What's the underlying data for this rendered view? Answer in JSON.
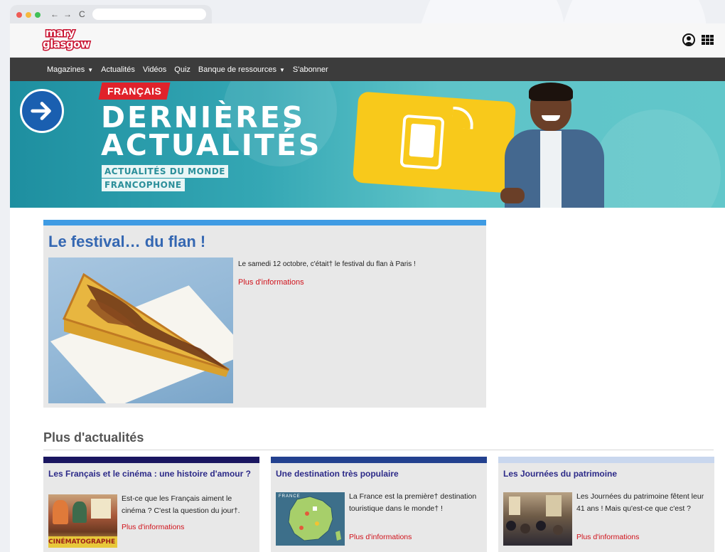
{
  "browser": {
    "back_icon": "←",
    "forward_icon": "→",
    "reload_icon": "C"
  },
  "header": {
    "logo_line1": "mary",
    "logo_line2": "glasgow"
  },
  "nav": {
    "items": [
      {
        "label": "Magazines",
        "dropdown": true
      },
      {
        "label": "Actualités",
        "dropdown": false
      },
      {
        "label": "Vidéos",
        "dropdown": false
      },
      {
        "label": "Quiz",
        "dropdown": false
      },
      {
        "label": "Banque de ressources",
        "dropdown": true
      },
      {
        "label": "S'abonner",
        "dropdown": false
      }
    ]
  },
  "banner": {
    "tag": "FRANÇAIS",
    "title_line1": "DERNIÈRES",
    "title_line2": "ACTUALITÉS",
    "sub_line1": "ACTUALITÉS DU MONDE",
    "sub_line2": "FRANCOPHONE"
  },
  "feature": {
    "title": "Le festival… du flan !",
    "text": "Le samedi 12 octobre, c'était† le festival du flan à Paris !",
    "more": "Plus d'informations"
  },
  "more_news": {
    "title": "Plus d'actualités",
    "cards": [
      {
        "title": "Les Français et le cinéma : une histoire d'amour ?",
        "text": "Est-ce que les Français aiment le cinéma ? C'est la question du jour†.",
        "more": "Plus d'informations",
        "image_caption": "CINÉMATOGRAPHE LUMIÈRE"
      },
      {
        "title": "Une destination très populaire",
        "text": "La France est la première† destination touristique dans le monde† !",
        "more": "Plus d'informations",
        "image_caption": "FRANCE"
      },
      {
        "title": "Les Journées du patrimoine",
        "text": "Les Journées du patrimoine fêtent leur 41 ans ! Mais qu'est-ce que c'est ?",
        "more": "Plus d'informations"
      }
    ]
  },
  "colors": {
    "nav_bg": "#3c3c3c",
    "feature_bar": "#3f9be3",
    "feature_title": "#3467b2",
    "link_red": "#d0121b",
    "card_title": "#2c2a88",
    "brand_red": "#c8102e"
  }
}
